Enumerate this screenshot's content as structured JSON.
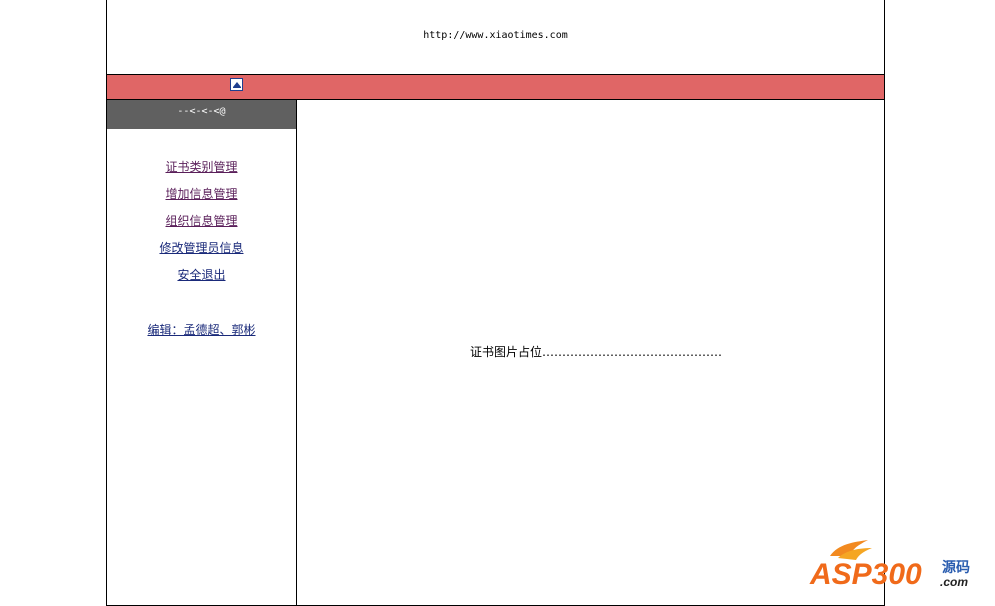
{
  "header": {
    "url": "http://www.xiaotimes.com"
  },
  "collapse_bar": {
    "icon": "collapse-up-icon",
    "color": "#e06666"
  },
  "sidebar": {
    "head_label": "--<-<-<@",
    "head_color": "#606060",
    "items": [
      {
        "label": "证书类别管理"
      },
      {
        "label": "增加信息管理"
      },
      {
        "label": "组织信息管理"
      },
      {
        "label": "修改管理员信息"
      },
      {
        "label": "安全退出"
      }
    ],
    "editor": "编辑：孟德超、郭彬"
  },
  "content": {
    "placeholder": "证书图片占位………………………………………"
  },
  "watermark": {
    "brand": "ASP300",
    "suffix": "源码",
    "domain": ".com"
  }
}
